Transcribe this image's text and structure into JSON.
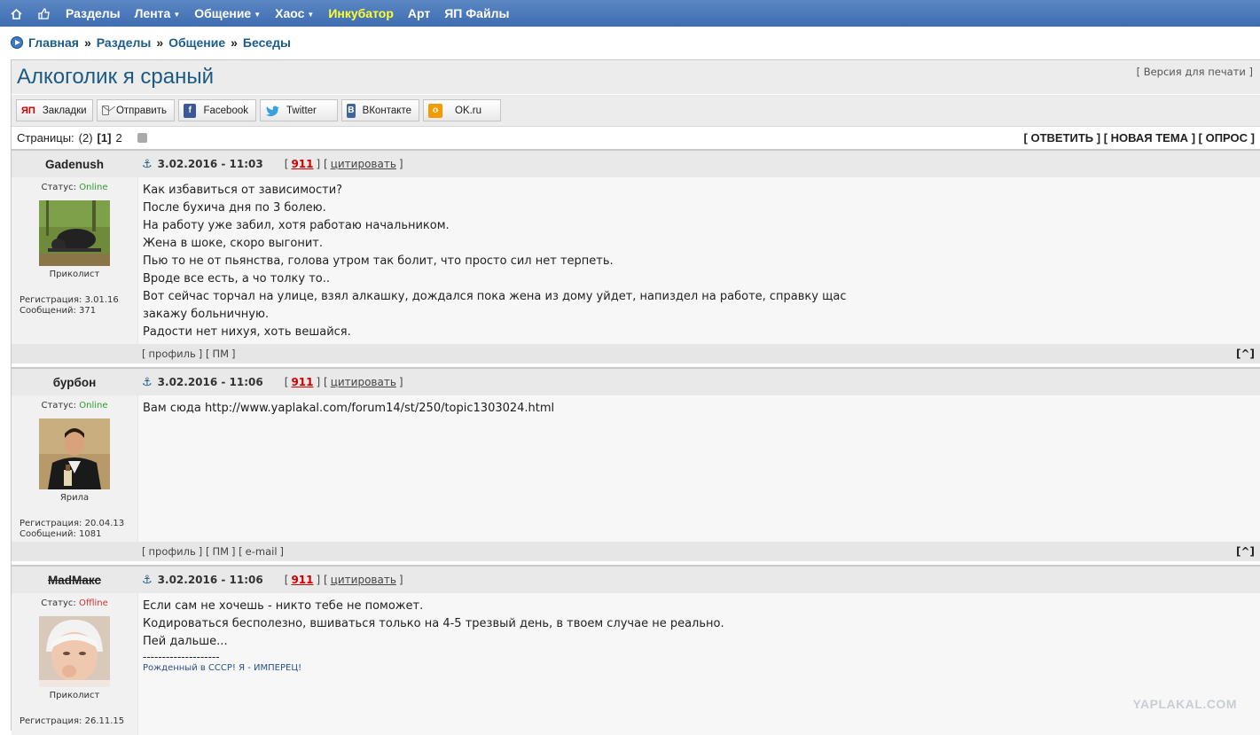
{
  "nav": {
    "home_icon": "home-icon",
    "like_icon": "thumbs-up-icon",
    "items": [
      {
        "label": "Разделы",
        "dropdown": false
      },
      {
        "label": "Лента",
        "dropdown": true
      },
      {
        "label": "Общение",
        "dropdown": true
      },
      {
        "label": "Хаос",
        "dropdown": true
      },
      {
        "label": "Инкубатор",
        "dropdown": false,
        "highlight": true
      },
      {
        "label": "Арт",
        "dropdown": false
      },
      {
        "label": "ЯП Файлы",
        "dropdown": false
      }
    ],
    "colors": {
      "bar": "#4a78b8",
      "highlight": "#ffff33"
    }
  },
  "breadcrumb": {
    "items": [
      "Главная",
      "Разделы",
      "Общение",
      "Беседы"
    ],
    "separator": "»"
  },
  "topic": {
    "title": "Алкоголик я сраный",
    "print_link": "Версия для печати"
  },
  "share": [
    {
      "label": "Закладки",
      "icon": "yp-icon",
      "icon_text": "ЯП"
    },
    {
      "label": "Отправить",
      "icon": "mail-icon",
      "icon_text": ""
    },
    {
      "label": "Facebook",
      "icon": "facebook-icon",
      "icon_text": "f"
    },
    {
      "label": "Twitter",
      "icon": "twitter-icon",
      "icon_text": "t"
    },
    {
      "label": "ВКонтакте",
      "icon": "vk-icon",
      "icon_text": "B"
    },
    {
      "label": "OK.ru",
      "icon": "ok-icon",
      "icon_text": "o"
    }
  ],
  "pages": {
    "label": "Страницы:",
    "count": "(2)",
    "current": "[1]",
    "next": "2"
  },
  "actions": {
    "reply": "ОТВЕТИТЬ",
    "new_topic": "НОВАЯ ТЕМА",
    "poll": "ОПРОС"
  },
  "posts": [
    {
      "author": "Gadenush",
      "strike": false,
      "status_label": "Статус:",
      "status": "Online",
      "rank": "Приколист",
      "registered": "Регистрация: 3.01.16",
      "messages": "Сообщений: 371",
      "date": "3.02.2016 - 11:03",
      "rating": "911",
      "quote": "цитировать",
      "lines": [
        "Как избавиться от зависимости?",
        "После бухича дня по 3 болею.",
        "На работу уже забил, хотя работаю начальником.",
        "Жена в шоке, скоро выгонит.",
        "Пью то не от пьянства, голова утром так болит, что просто сил нет терпеть.",
        "Вроде все есть, а чо толку то..",
        "Вот сейчас торчал на улице, взял алкашку, дождался пока жена из дому уйдет, напиздел на работе, справку щас",
        "закажу больничную.",
        "Радости нет нихуя, хоть вешайся."
      ],
      "foot_links": [
        "профиль",
        "ПМ"
      ]
    },
    {
      "author": "бурбон",
      "strike": false,
      "status_label": "Статус:",
      "status": "Online",
      "rank": "Ярила",
      "registered": "Регистрация: 20.04.13",
      "messages": "Сообщений: 1081",
      "date": "3.02.2016 - 11:06",
      "rating": "911",
      "quote": "цитировать",
      "text_prefix": "Вам сюда ",
      "link": "http://www.yaplakal.com/forum14/st/250/topic1303024.html",
      "foot_links": [
        "профиль",
        "ПМ",
        "e-mail"
      ]
    },
    {
      "author": "MadМакс",
      "strike": true,
      "status_label": "Статус:",
      "status": "Offline",
      "rank": "Приколист",
      "registered": "Регистрация: 26.11.15",
      "date": "3.02.2016 - 11:06",
      "rating": "911",
      "quote": "цитировать",
      "lines": [
        "Если сам не хочешь - никто тебе не поможет.",
        "Кодироваться бесполезно, вшиваться только на 4-5 трезвый день, в твоем случае не реально.",
        "Пей дальше..."
      ],
      "sig_sep": "--------------------",
      "signature": "Рожденный в СССР! Я - ИМПЕРЕЦ!"
    }
  ],
  "up_label": "[^]",
  "watermark": "YAPLAKAL.COM"
}
